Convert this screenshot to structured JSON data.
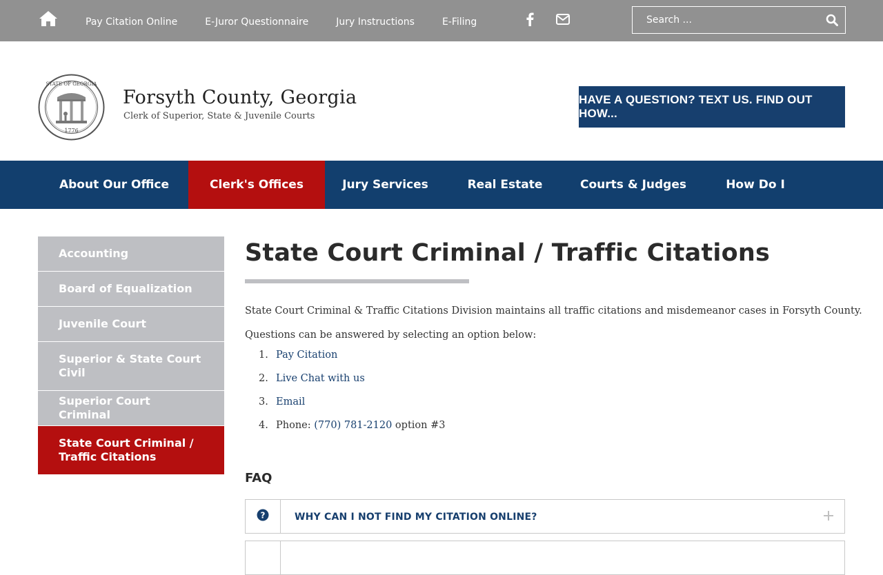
{
  "topbar": {
    "links": [
      "Pay Citation Online",
      "E-Juror Questionnaire",
      "Jury Instructions",
      "E-Filing"
    ],
    "search_placeholder": "Search ..."
  },
  "header": {
    "title": "Forsyth County, Georgia",
    "subtitle": "Clerk of Superior, State & Juvenile Courts",
    "cta": "HAVE A QUESTION? TEXT US. FIND OUT HOW...",
    "seal_text": "STATE OF GEORGIA 1776 CONSTITUTION WISDOM JUSTICE MODERATION"
  },
  "nav": {
    "items": [
      "About Our Office",
      "Clerk's Offices",
      "Jury Services",
      "Real Estate",
      "Courts & Judges",
      "How Do I"
    ],
    "active": "Clerk's Offices"
  },
  "sidebar": {
    "items": [
      "Accounting",
      "Board of Equalization",
      "Juvenile Court",
      "Superior & State Court Civil",
      "Superior Court Criminal",
      "State Court Criminal / Traffic Citations"
    ],
    "active": "State Court Criminal / Traffic Citations"
  },
  "main": {
    "title": "State Court Criminal / Traffic Citations",
    "intro": "State Court Criminal & Traffic Citations Division maintains all traffic citations and misdemeanor cases in Forsyth County.",
    "questions_text": "Questions can be answered by selecting an option below:",
    "options": [
      {
        "num": "1.",
        "link": "Pay Citation",
        "prefix": "",
        "suffix": ""
      },
      {
        "num": "2.",
        "link": "Live Chat with us",
        "prefix": "",
        "suffix": ""
      },
      {
        "num": "3.",
        "link": "Email",
        "prefix": "",
        "suffix": ""
      },
      {
        "num": "4.",
        "link": "(770) 781-2120",
        "prefix": "Phone: ",
        "suffix": " option #3"
      }
    ],
    "faq_heading": "FAQ",
    "faq": [
      "WHY CAN I NOT FIND MY CITATION ONLINE?",
      ""
    ]
  },
  "colors": {
    "topbar": "#919191",
    "navy": "#123f6e",
    "red": "#b40f0f",
    "sidebar_gray": "#bebfc3"
  }
}
